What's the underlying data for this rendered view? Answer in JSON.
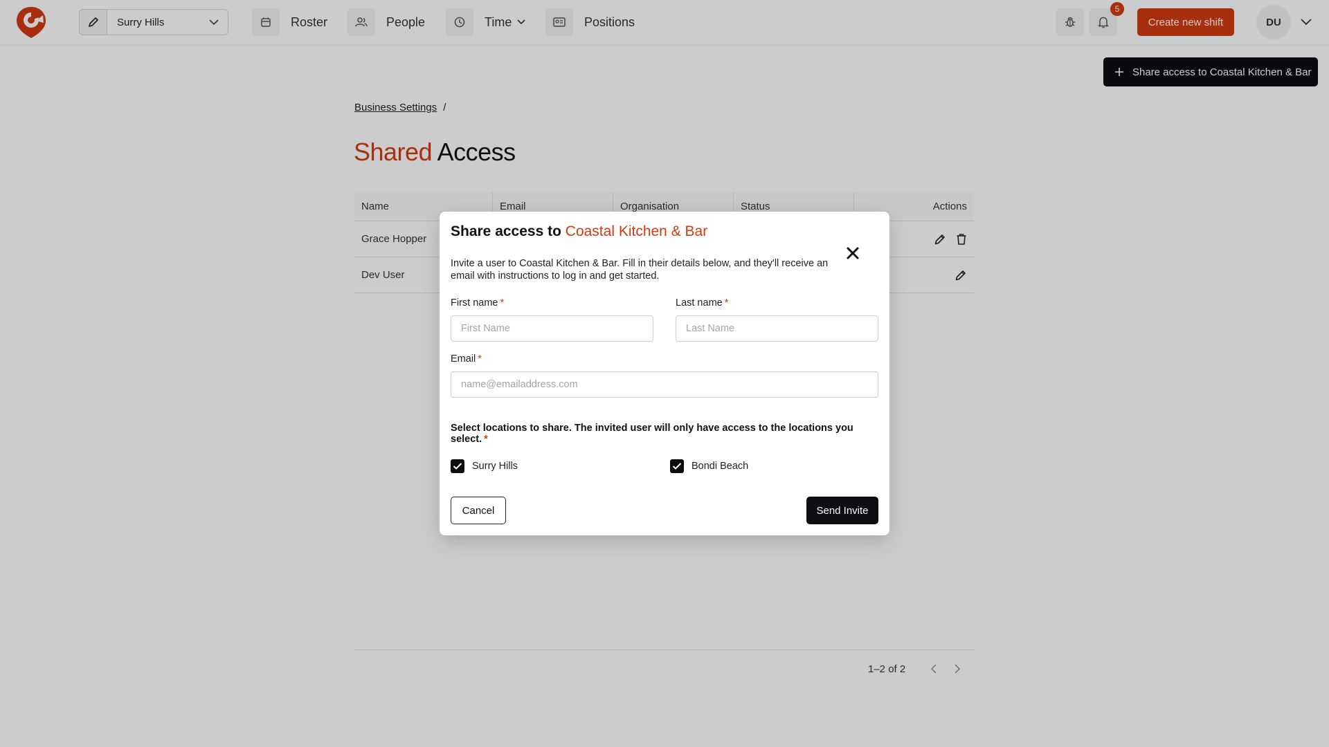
{
  "nav": {
    "location": "Surry Hills",
    "items": [
      {
        "label": "Roster"
      },
      {
        "label": "People"
      },
      {
        "label": "Time"
      },
      {
        "label": "Positions"
      }
    ],
    "notification_count": "5",
    "create_shift_label": "Create new shift",
    "avatar_initials": "DU"
  },
  "page": {
    "share_button_label": "Share access to Coastal Kitchen & Bar",
    "breadcrumb": {
      "link": "Business Settings",
      "separator": "/"
    },
    "title_accent": "Shared",
    "title_rest": "Access",
    "table": {
      "headers": [
        "Name",
        "Email",
        "Organisation",
        "Status",
        "Actions"
      ],
      "rows": [
        {
          "name": "Grace Hopper"
        },
        {
          "name": "Dev User"
        }
      ]
    },
    "pagination": "1–2 of 2"
  },
  "modal": {
    "title_prefix": "Share access to",
    "title_accent": "Coastal Kitchen & Bar",
    "description": "Invite a user to Coastal Kitchen & Bar. Fill in their details below, and they'll receive an email with instructions to log in and get started.",
    "first_name_label": "First name",
    "first_name_placeholder": "First Name",
    "last_name_label": "Last name",
    "last_name_placeholder": "Last Name",
    "email_label": "Email",
    "email_placeholder": "name@emailaddress.com",
    "required_mark": "*",
    "locations_note": "Select locations to share. The invited user will only have access to the locations you select.",
    "locations": [
      {
        "name": "Surry Hills",
        "checked": true
      },
      {
        "name": "Bondi Beach",
        "checked": true
      }
    ],
    "cancel_label": "Cancel",
    "send_label": "Send Invite"
  },
  "colors": {
    "brand": "#d13a13",
    "dark": "#0d0d12"
  }
}
